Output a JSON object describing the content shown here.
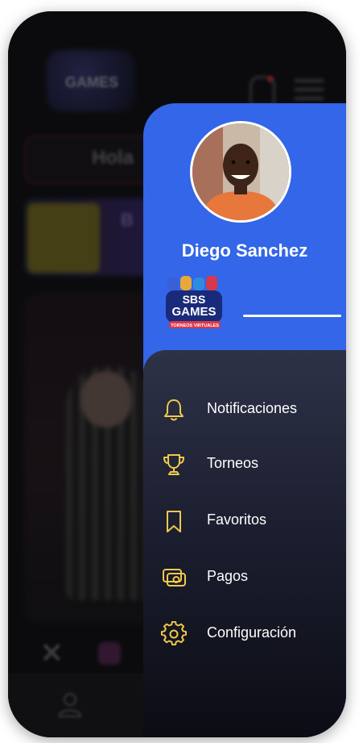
{
  "background_app": {
    "logo_text": "GAMES",
    "greeting": "Hola",
    "card_title": "B"
  },
  "drawer": {
    "user_name": "Diego Sanchez",
    "brand": {
      "line1": "SBS",
      "line2": "GAMES",
      "tagline": "TORNEOS VIRTUALES"
    },
    "menu": [
      {
        "label": "Notificaciones",
        "icon": "bell-icon"
      },
      {
        "label": "Torneos",
        "icon": "trophy-icon"
      },
      {
        "label": "Favoritos",
        "icon": "bookmark-icon"
      },
      {
        "label": "Pagos",
        "icon": "payments-icon"
      },
      {
        "label": "Configuración",
        "icon": "gear-icon"
      }
    ]
  },
  "colors": {
    "drawer_blue": "#3366e8",
    "icon_yellow": "#f2c94c",
    "menu_dark": "#1c1f30"
  }
}
